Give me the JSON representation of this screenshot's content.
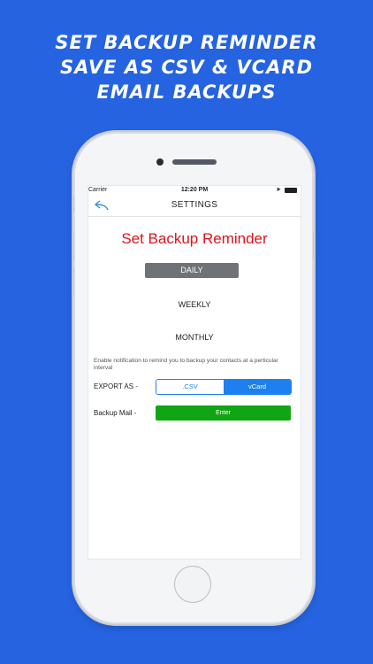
{
  "promo": {
    "line1": "Set Backup Reminder",
    "line2": "Save as CSV & vCard",
    "line3": "Email Backups"
  },
  "status": {
    "carrier": "Carrier",
    "time": "12:20 PM"
  },
  "nav": {
    "title": "SETTINGS",
    "back_icon": "back-arrow-icon"
  },
  "reminder": {
    "heading": "Set Backup Reminder",
    "options": [
      "DAILY",
      "WEEKLY",
      "MONTHLY"
    ],
    "selected": "DAILY",
    "note": "Enable notification to remind you to backup your contacts at a perticular interval"
  },
  "export": {
    "label": "EXPORT AS -",
    "csv": ".CSV",
    "vcard": "vCard",
    "selected": "vCard"
  },
  "mail": {
    "label": "Backup Mail -",
    "button": "Enter"
  },
  "colors": {
    "background": "#2563e0",
    "heading": "#e0121b",
    "accent": "#1e7ff0",
    "enter_button": "#11a513",
    "selected_option": "#6f7378"
  }
}
